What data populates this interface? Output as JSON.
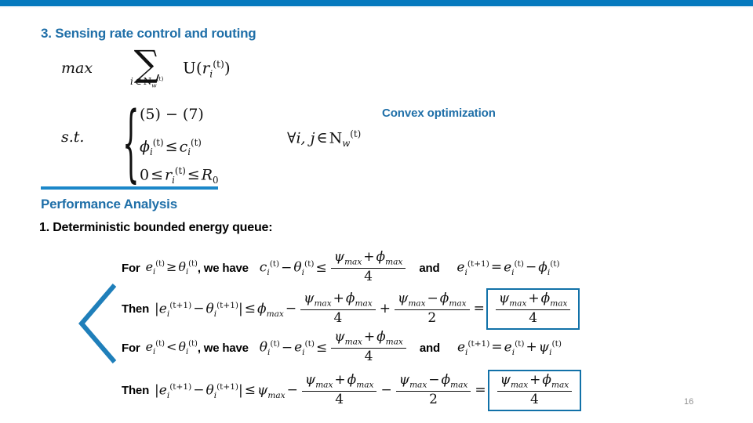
{
  "slide": {
    "page_number": "16",
    "accent_color": "#0579be",
    "title_color": "#1f6fa8",
    "rule_color": "#1b87c9",
    "box_border_color": "#1171a8",
    "chevron_color": "#1f7fba"
  },
  "section": {
    "title": "3. Sensing rate control and routing",
    "callout": "Convex optimization"
  },
  "optimization": {
    "objective_label": "max",
    "sum_symbol": "∑",
    "sum_subscript_i": "i",
    "sum_subscript_in": "∈",
    "sum_subscript_set": "N",
    "sum_subscript_set_sub": "w",
    "sum_subscript_set_sup": "(t)",
    "objective_fn": "U",
    "objective_var": "r",
    "objective_var_sub": "i",
    "objective_var_sup": "(t)",
    "st_label": "s.t.",
    "constraint_1": "(5) − (7)",
    "constraint_2": {
      "lhs": "ϕ",
      "lhs_sub": "i",
      "lhs_sup": "(t)",
      "rel": "≤",
      "rhs": "c",
      "rhs_sub": "i",
      "rhs_sup": "(t)"
    },
    "constraint_3": {
      "zero": "0",
      "rel1": "≤",
      "var": "r",
      "var_sub": "i",
      "var_sup": "(t)",
      "rel2": "≤",
      "bound": "R",
      "bound_sub": "0"
    },
    "forall": {
      "quant": "∀",
      "vars": "i, j",
      "in": "∈",
      "set": "N",
      "set_sub": "w",
      "set_sup": "(t)"
    }
  },
  "performance": {
    "heading": "Performance Analysis",
    "item_1": "1. Deterministic bounded energy queue:"
  },
  "derivation": {
    "labels": {
      "for": "For",
      "we_have": ", we have",
      "and": "and",
      "then": "Then"
    },
    "symbols": {
      "e": "e",
      "theta": "θ",
      "phi": "ϕ",
      "psi": "ψ",
      "c": "c",
      "max_sub": "max",
      "i": "i",
      "t": "(t)",
      "t_plus_1": "(t+1)",
      "ge": "≥",
      "lt": "<",
      "le": "≤",
      "eq": "=",
      "plus": "+",
      "minus": "−",
      "four": "4",
      "two": "2",
      "abs": "|"
    },
    "rows": [
      {
        "id": "for-1",
        "lead": "For",
        "condition": "e_i^(t) ≥ θ_i^(t)",
        "tail": ", we have",
        "inequality": "c_i^(t) − θ_i^(t) ≤ (ψmax + ϕmax)/4",
        "conjunction": "and",
        "update": "e_i^(t+1) = e_i^(t) − ϕ_i^(t)"
      },
      {
        "id": "then-1",
        "lead": "Then",
        "expression": "|e_i^(t+1) − θ_i^(t+1)| ≤ ϕmax − (ψmax + ϕmax)/4 + (ψmax − ϕmax)/2",
        "result": "(ψmax + ϕmax)/4",
        "boxed": true
      },
      {
        "id": "for-2",
        "lead": "For",
        "condition": "e_i^(t) < θ_i^(t)",
        "tail": ", we have",
        "inequality": "θ_i^(t) − e_i^(t) ≤ (ψmax + ϕmax)/4",
        "conjunction": "and",
        "update": "e_i^(t+1) = e_i^(t) + ψ_i^(t)"
      },
      {
        "id": "then-2",
        "lead": "Then",
        "expression": "|e_i^(t+1) − θ_i^(t+1)| ≤ ψmax − (ψmax + ϕmax)/4 − (ψmax − ϕmax)/2",
        "result": "(ψmax + ϕmax)/4",
        "boxed": true
      }
    ]
  }
}
